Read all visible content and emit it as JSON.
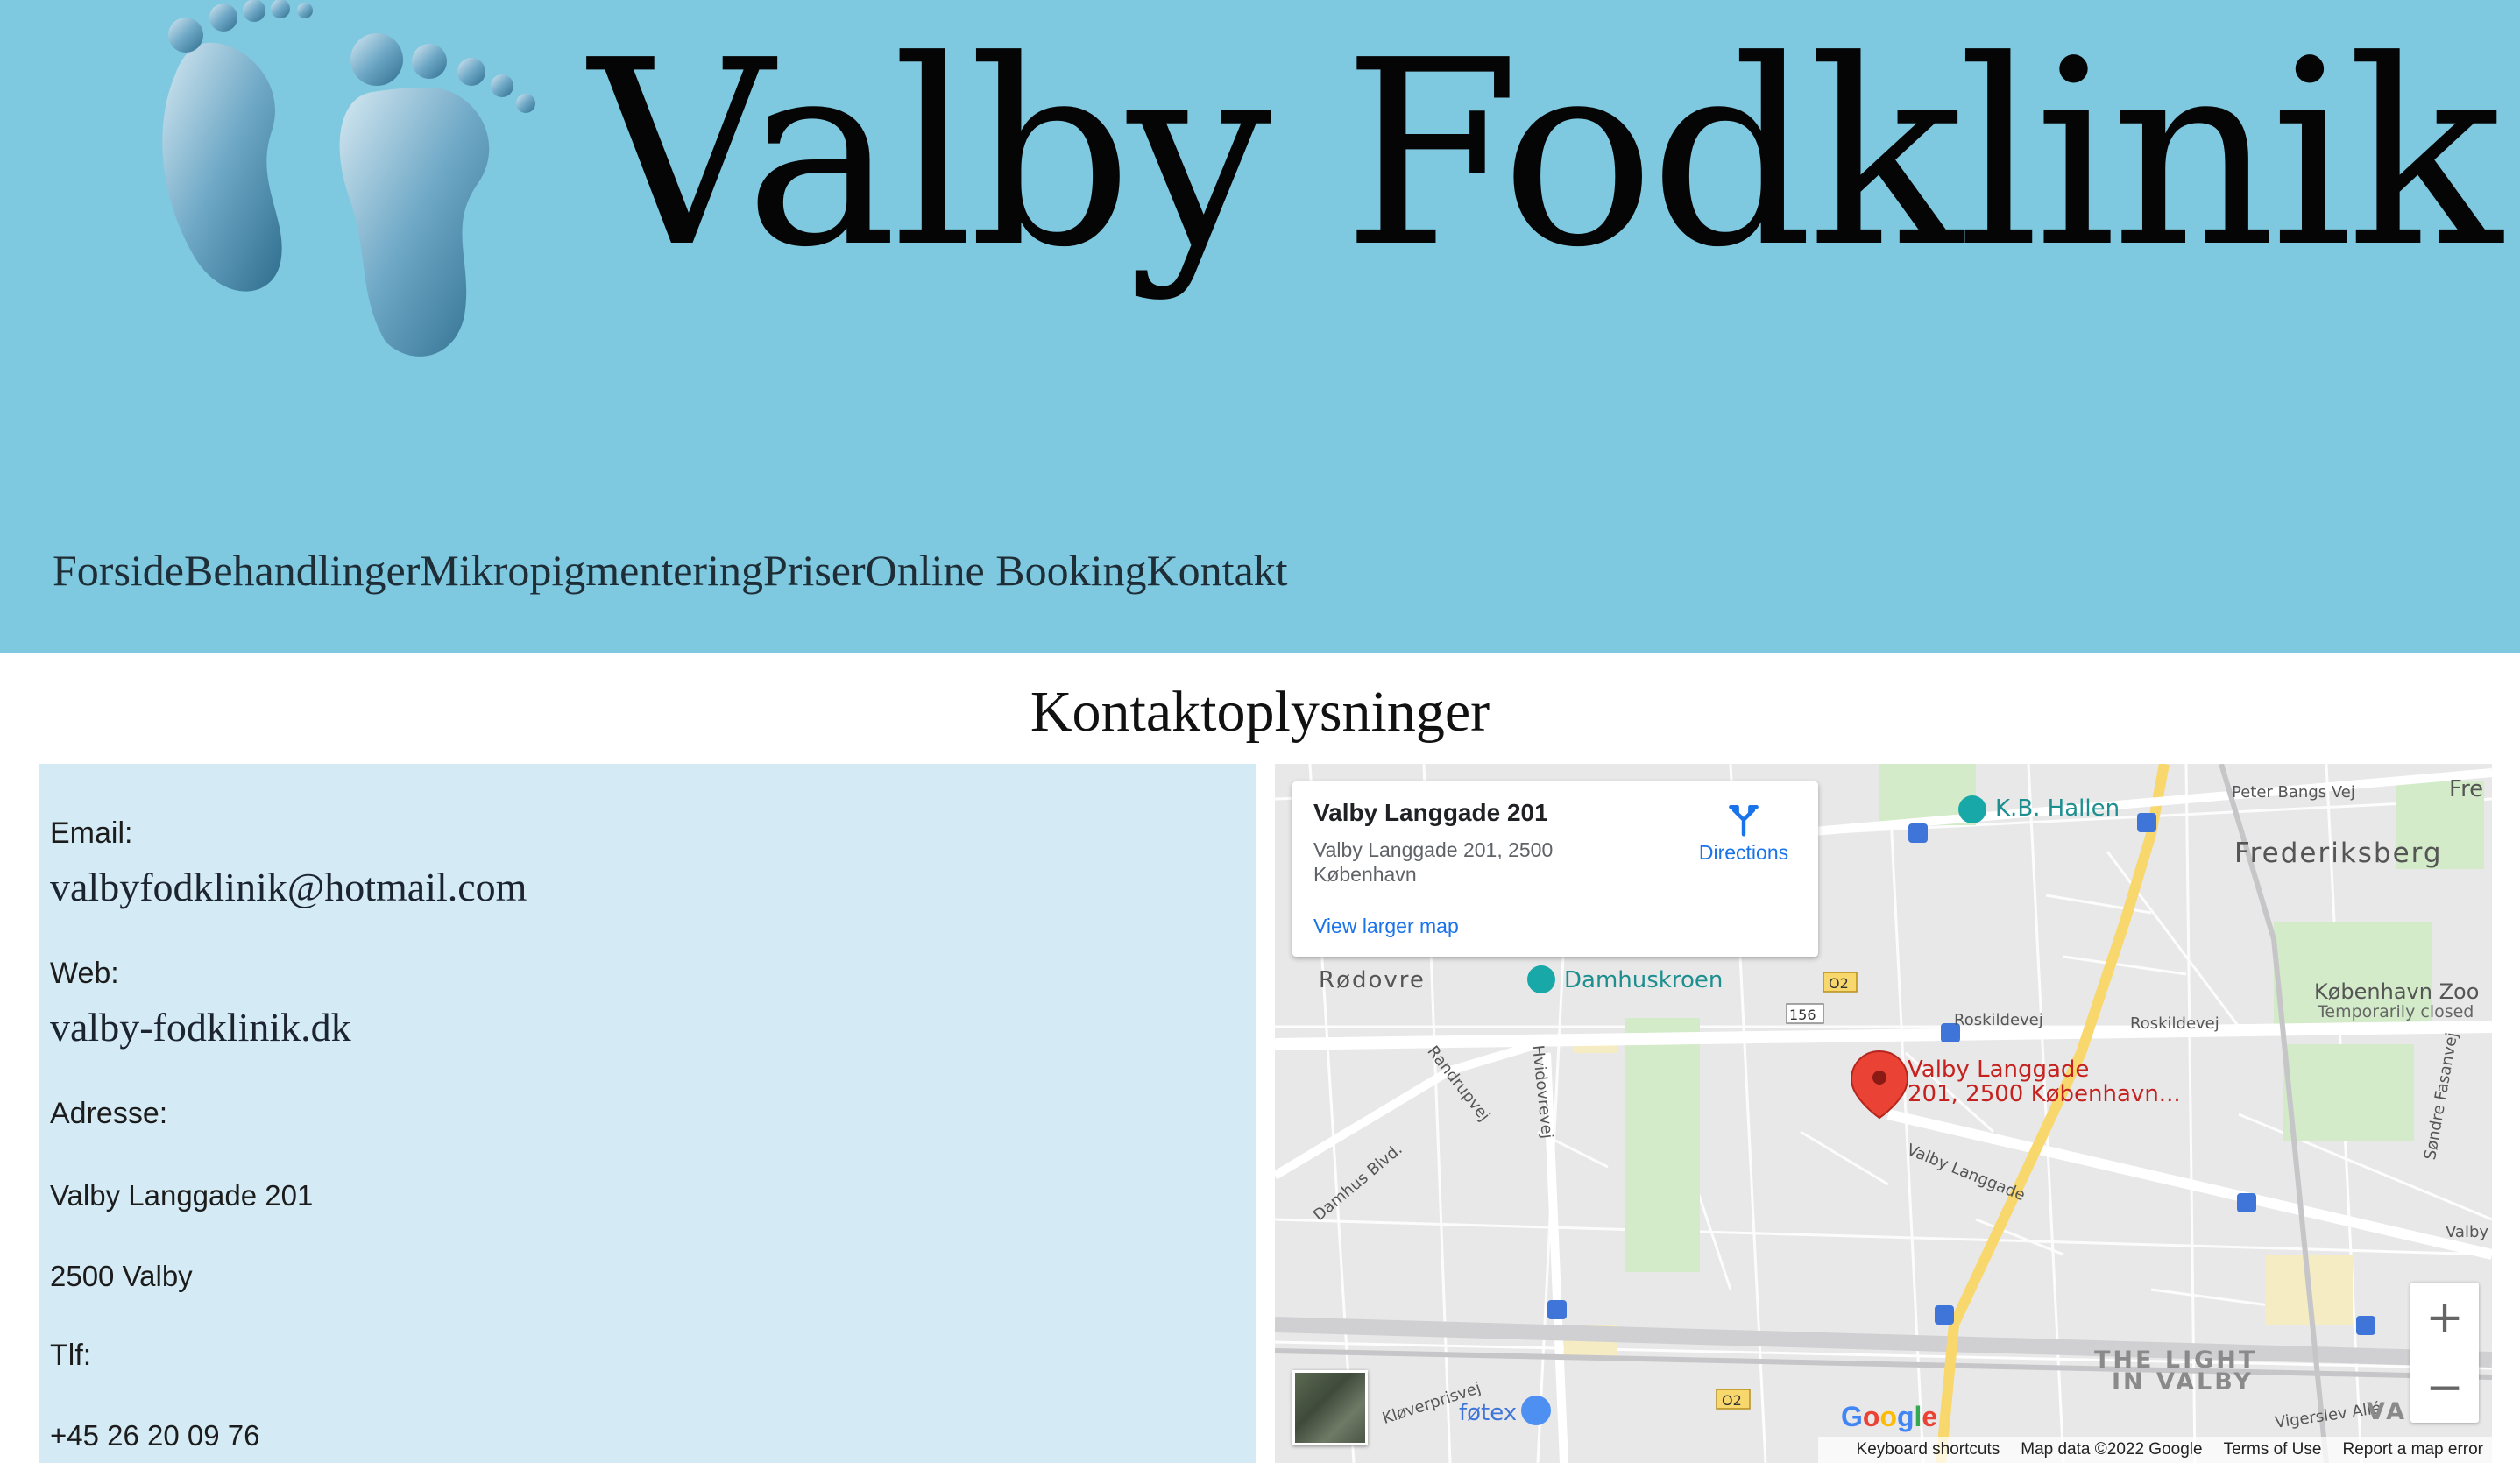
{
  "header": {
    "site_title": "Valby Fodklinik",
    "logo_icon": "feet-logo-icon",
    "background_color": "#7ec8e0"
  },
  "nav": {
    "items": [
      {
        "label": "Forside"
      },
      {
        "label": "Behandlinger"
      },
      {
        "label": "Mikropigmentering"
      },
      {
        "label": "Priser"
      },
      {
        "label": "Online Booking"
      },
      {
        "label": "Kontakt"
      }
    ]
  },
  "contact": {
    "title": "Kontaktoplysninger",
    "email_label": "Email:",
    "email_value": "valbyfodklinik@hotmail.com",
    "web_label": "Web:",
    "web_value": "valby-fodklinik.dk",
    "address_label": "Adresse:",
    "address_line1": "Valby Langgade 201",
    "address_line2": "2500 Valby",
    "phone_label": "Tlf:",
    "phone_value": "+45 26 20 09 76",
    "panel_color": "#d4ebf5"
  },
  "map": {
    "card": {
      "title": "Valby Langgade 201",
      "address": "Valby Langgade 201, 2500 København",
      "directions_label": "Directions",
      "view_larger_label": "View larger map"
    },
    "marker_label_line1": "Valby Langgade",
    "marker_label_line2": "201, 2500 København...",
    "places": {
      "kb_hallen": "K.B. Hallen",
      "frederiksberg": "Frederiksberg",
      "rodovre": "Rødovre",
      "damhuskroen": "Damhuskroen",
      "kbh_zoo": "København Zoo",
      "zoo_status": "Temporarily closed",
      "roskildevej1": "Roskildevej",
      "roskildevej2": "Roskildevej",
      "valby_langgade_road": "Valby Langgade",
      "randrupvej": "Randrupvej",
      "hvidovrevej": "Hvidovrevej",
      "damhus_blvd": "Damhus Blvd.",
      "peter_bangs_vej": "Peter Bangs Vej",
      "the_light": "THE LIGHT",
      "in_valby": "IN VALBY",
      "fotex": "føtex",
      "kloverprisvej": "Kløverprisvej",
      "vigerslev_alle": "Vigerslev Allé",
      "sondre_fasanvej": "Søndre Fasanvej",
      "valby_edge": "Valby",
      "va": "VA",
      "fre": "Fre",
      "road_156": "156",
      "road_o2a": "O2",
      "road_o2b": "O2"
    },
    "zoom_in": "+",
    "zoom_out": "−",
    "google": "Google",
    "footer": {
      "shortcuts": "Keyboard shortcuts",
      "data": "Map data ©2022 Google",
      "terms": "Terms of Use",
      "report": "Report a map error"
    },
    "marker_color": "#ea4335",
    "link_color": "#1a73e8"
  }
}
